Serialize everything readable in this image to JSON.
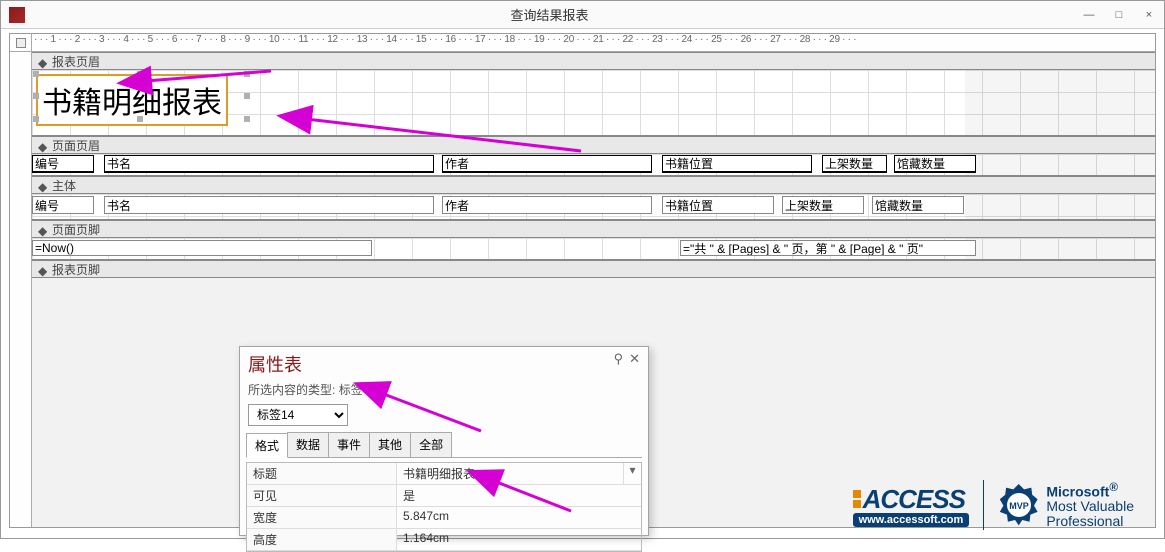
{
  "window": {
    "title": "查询结果报表",
    "minimize": "—",
    "maximize": "□",
    "close": "×"
  },
  "ruler": "· · · 1 · · · 2 · · · 3 · · · 4 · · · 5 · · · 6 · · · 7 · · · 8 · · · 9 · · · 10 · · · 11 · · · 12 · · · 13 · · · 14 · · · 15 · · · 16 · · · 17 · · · 18 · · · 19 · · · 20 · · · 21 · · · 22 · · · 23 · · · 24 · · · 25 · · · 26 · · · 27 · · · 28 · · · 29 · · ·",
  "sections": {
    "report_header": "报表页眉",
    "page_header": "页面页眉",
    "detail": "主体",
    "page_footer": "页面页脚",
    "report_footer": "报表页脚"
  },
  "big_title": "书籍明细报表",
  "page_header_labels": {
    "c1": "编号",
    "c2": "书名",
    "c3": "作者",
    "c4": "书籍位置",
    "c5": "上架数量",
    "c6": "馆藏数量"
  },
  "detail_fields": {
    "f1": "编号",
    "f2": "书名",
    "f3": "作者",
    "f4": "书籍位置",
    "f5": "上架数量",
    "f6": "馆藏数量"
  },
  "page_footer_fields": {
    "left": "=Now()",
    "right": "=\"共 \" & [Pages] & \" 页，第 \" & [Page] & \" 页\""
  },
  "property_sheet": {
    "title": "属性表",
    "subtitle_prefix": "所选内容的类型:",
    "subtitle_type": "标签",
    "selected_object": "标签14",
    "tabs": {
      "format": "格式",
      "data": "数据",
      "event": "事件",
      "other": "其他",
      "all": "全部"
    },
    "rows": {
      "caption_k": "标题",
      "caption_v": "书籍明细报表",
      "visible_k": "可见",
      "visible_v": "是",
      "width_k": "宽度",
      "width_v": "5.847cm",
      "height_k": "高度",
      "height_v": "1.164cm"
    },
    "pin_icon": "⚲",
    "close_icon": "✕"
  },
  "logos": {
    "access_brand": "ACCESS",
    "access_url": "www.accessoft.com",
    "mvp_badge": "MVP",
    "ms": "Microsoft",
    "reg": "®",
    "mv": "Most Valuable",
    "pro": "Professional"
  }
}
